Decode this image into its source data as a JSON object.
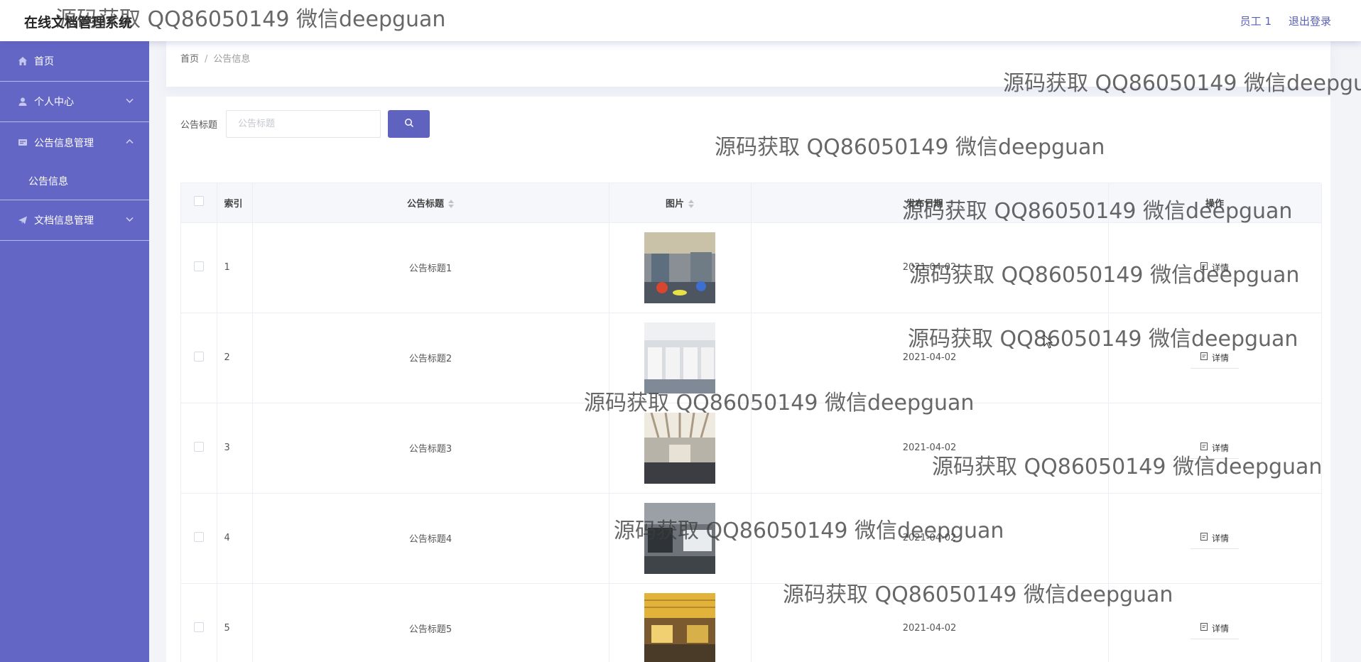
{
  "app": {
    "title": "在线文档管理系统"
  },
  "header": {
    "user_label": "员工 1",
    "logout_label": "退出登录"
  },
  "sidebar": {
    "items": [
      {
        "label": "首页",
        "icon": "home-icon",
        "expandable": false
      },
      {
        "label": "个人中心",
        "icon": "user-icon",
        "expandable": true,
        "expanded": false
      },
      {
        "label": "公告信息管理",
        "icon": "notice-icon",
        "expandable": true,
        "expanded": true,
        "children": [
          {
            "label": "公告信息"
          }
        ]
      },
      {
        "label": "文档信息管理",
        "icon": "paper-plane-icon",
        "expandable": true,
        "expanded": false
      }
    ]
  },
  "breadcrumb": {
    "home": "首页",
    "separator": "/",
    "current": "公告信息"
  },
  "search": {
    "label": "公告标题",
    "placeholder": "公告标题",
    "value": ""
  },
  "table": {
    "columns": [
      "索引",
      "公告标题",
      "图片",
      "发布日期",
      "操作"
    ],
    "rows": [
      {
        "index": "1",
        "title": "公告标题1",
        "date": "2021-04-02",
        "action": "详情"
      },
      {
        "index": "2",
        "title": "公告标题2",
        "date": "2021-04-02",
        "action": "详情"
      },
      {
        "index": "3",
        "title": "公告标题3",
        "date": "2021-04-02",
        "action": "详情"
      },
      {
        "index": "4",
        "title": "公告标题4",
        "date": "2021-04-02",
        "action": "详情"
      },
      {
        "index": "5",
        "title": "公告标题5",
        "date": "2021-04-02",
        "action": "详情"
      }
    ]
  },
  "watermark": {
    "text": "源码获取 QQ86050149 微信deepguan"
  },
  "colors": {
    "sidebar": "#6466c6",
    "accent": "#5f63bf",
    "header_link": "#5a5fb8"
  }
}
